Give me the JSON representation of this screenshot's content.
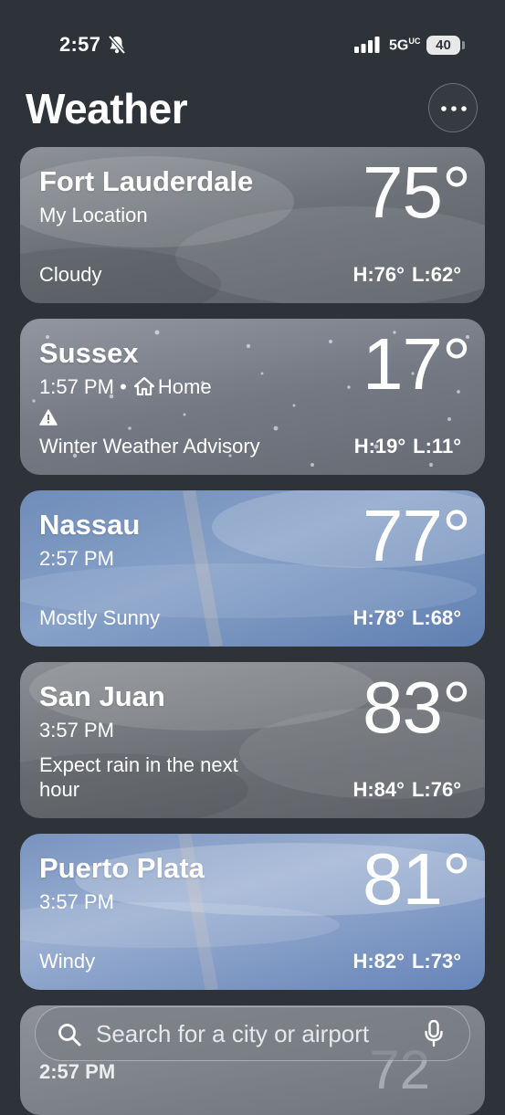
{
  "status_bar": {
    "time": "2:57",
    "network": "5G",
    "network_suffix": "UC",
    "battery": "40"
  },
  "header": {
    "title": "Weather"
  },
  "locations": [
    {
      "city": "Fort Lauderdale",
      "subtitle": "My Location",
      "temp": "75°",
      "condition": "Cloudy",
      "high": "H:76°",
      "low": "L:62°"
    },
    {
      "city": "Sussex",
      "time": "1:57 PM",
      "separator": "•",
      "home_label": "Home",
      "temp": "17°",
      "condition": "Winter Weather Advisory",
      "high": "H:19°",
      "low": "L:11°"
    },
    {
      "city": "Nassau",
      "time": "2:57 PM",
      "temp": "77°",
      "condition": "Mostly Sunny",
      "high": "H:78°",
      "low": "L:68°"
    },
    {
      "city": "San Juan",
      "time": "3:57 PM",
      "temp": "83°",
      "condition": "Expect rain in the next hour",
      "high": "H:84°",
      "low": "L:76°"
    },
    {
      "city": "Puerto Plata",
      "time": "3:57 PM",
      "temp": "81°",
      "condition": "Windy",
      "high": "H:82°",
      "low": "L:73°"
    },
    {
      "time": "2:57 PM",
      "temp": "72"
    }
  ],
  "search": {
    "placeholder": "Search for a city or airport"
  },
  "icons": {
    "bell": "bell-slash-icon",
    "signal": "signal-bars-icon",
    "more": "ellipsis-icon",
    "home": "house-icon",
    "alert": "warning-triangle-icon",
    "search": "magnifier-icon",
    "mic": "microphone-icon"
  }
}
